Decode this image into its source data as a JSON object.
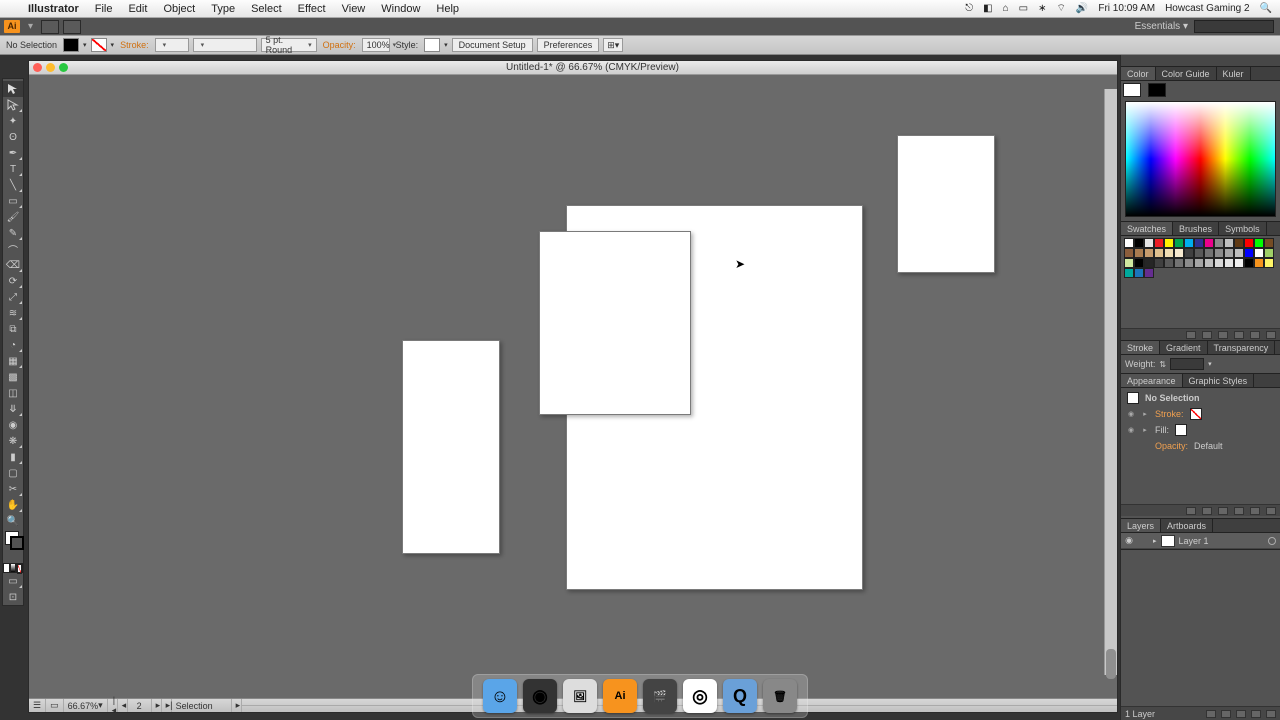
{
  "menubar": {
    "apple": "",
    "app": "Illustrator",
    "items": [
      "File",
      "Edit",
      "Object",
      "Type",
      "Select",
      "Effect",
      "View",
      "Window",
      "Help"
    ],
    "clock": "Fri 10:09 AM",
    "user": "Howcast Gaming 2"
  },
  "workspace": {
    "name": "Essentials"
  },
  "control": {
    "selection_label": "No Selection",
    "stroke_label": "Stroke:",
    "stroke_val": "",
    "brush_val": "",
    "profile_val": "5 pt. Round",
    "opacity_label": "Opacity:",
    "opacity_val": "100%",
    "style_label": "Style:",
    "btn_docsetup": "Document Setup",
    "btn_prefs": "Preferences"
  },
  "document": {
    "title": "Untitled-1* @ 66.67% (CMYK/Preview)",
    "artboards": 4
  },
  "statusbar": {
    "zoom": "66.67%",
    "artboard_num": "2",
    "tool": "Selection"
  },
  "panels": {
    "color": {
      "tabs": [
        "Color",
        "Color Guide",
        "Kuler"
      ],
      "active": 0
    },
    "swatches": {
      "tabs": [
        "Swatches",
        "Brushes",
        "Symbols"
      ],
      "active": 0
    },
    "stroke": {
      "tabs": [
        "Stroke",
        "Gradient",
        "Transparency"
      ],
      "active": 0,
      "weight_label": "Weight:"
    },
    "appearance": {
      "tabs": [
        "Appearance",
        "Graphic Styles"
      ],
      "active": 0,
      "header": "No Selection",
      "stroke_label": "Stroke:",
      "fill_label": "Fill:",
      "opacity_label": "Opacity:",
      "opacity_val": "Default"
    },
    "layers": {
      "tabs": [
        "Layers",
        "Artboards"
      ],
      "active": 0,
      "layer1": "Layer 1",
      "count": "1 Layer"
    }
  },
  "swatch_colors": [
    "#ffffff",
    "#000000",
    "#e6e6e6",
    "#ed1c24",
    "#fff200",
    "#00a651",
    "#00aeef",
    "#2e3192",
    "#ec008c",
    "#898989",
    "#c0c0c0",
    "#603913",
    "#ff0000",
    "#00ff00",
    "#754c24",
    "#8b5e3c",
    "#a97c50",
    "#c69c6d",
    "#e0c18f",
    "#f0deb5",
    "#f7ead0",
    "#404040",
    "#595959",
    "#737373",
    "#8c8c8c",
    "#a6a6a6",
    "#bfbfbf",
    "#0000ff",
    "#ffffff",
    "#a0cf67",
    "#d0e8a0",
    "#000000",
    "#262626",
    "#404040",
    "#595959",
    "#737373",
    "#8c8c8c",
    "#a6a6a6",
    "#bfbfbf",
    "#d9d9d9",
    "#e6e6e6",
    "#f2f2f2",
    "#000000",
    "#f7941d",
    "#fff568",
    "#00a99d",
    "#1b75bc",
    "#652d90"
  ],
  "dock": [
    {
      "name": "finder",
      "bg": "#5aa5e8",
      "glyph": "☺"
    },
    {
      "name": "dashboard",
      "bg": "#333",
      "glyph": "◉"
    },
    {
      "name": "preview",
      "bg": "#ddd",
      "glyph": "🖼"
    },
    {
      "name": "illustrator",
      "bg": "#f7931e",
      "glyph": "Ai"
    },
    {
      "name": "imovie",
      "bg": "#444",
      "glyph": "🎬"
    },
    {
      "name": "chrome",
      "bg": "#fff",
      "glyph": "◎"
    },
    {
      "name": "quicktime",
      "bg": "#6aa0d8",
      "glyph": "Q"
    },
    {
      "name": "trash",
      "bg": "#888",
      "glyph": "🗑"
    }
  ]
}
